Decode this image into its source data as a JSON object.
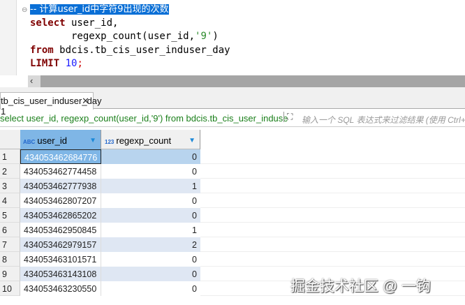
{
  "editor": {
    "comment": "-- 计算user_id中字符9出现的次数",
    "line2_kw": "select",
    "line2_rest": " user_id,",
    "line3": "       regexp_count(user_id,",
    "line3_str": "'9'",
    "line3_end": ")",
    "line4_kw": "from",
    "line4_rest": " bdcis.tb_cis_user_induser_day",
    "line5_kw": "LIMIT",
    "line5_num": "10",
    "line5_end": ";"
  },
  "results_tab": {
    "label": "tb_cis_user_induser_day 1",
    "close": "✕"
  },
  "filter": {
    "query": "select user_id, regexp_count(user_id,'9') from bdcis.tb_cis_user_induse",
    "placeholder": "输入一个 SQL 表达式来过滤结果 (使用 Ctrl+"
  },
  "grid": {
    "columns": [
      {
        "type_icon": "ABC",
        "label": "user_id"
      },
      {
        "type_icon": "123",
        "label": "regexp_count"
      }
    ],
    "rows": [
      [
        "1",
        "434053462684776",
        "0"
      ],
      [
        "2",
        "434053462774458",
        "0"
      ],
      [
        "3",
        "434053462777938",
        "1"
      ],
      [
        "4",
        "434053462807207",
        "0"
      ],
      [
        "5",
        "434053462865202",
        "0"
      ],
      [
        "6",
        "434053462950845",
        "1"
      ],
      [
        "7",
        "434053462979157",
        "2"
      ],
      [
        "8",
        "434053463101571",
        "0"
      ],
      [
        "9",
        "434053463143108",
        "0"
      ],
      [
        "10",
        "434053463230550",
        "0"
      ]
    ]
  },
  "watermark": "掘金技术社区 @ 一钩"
}
